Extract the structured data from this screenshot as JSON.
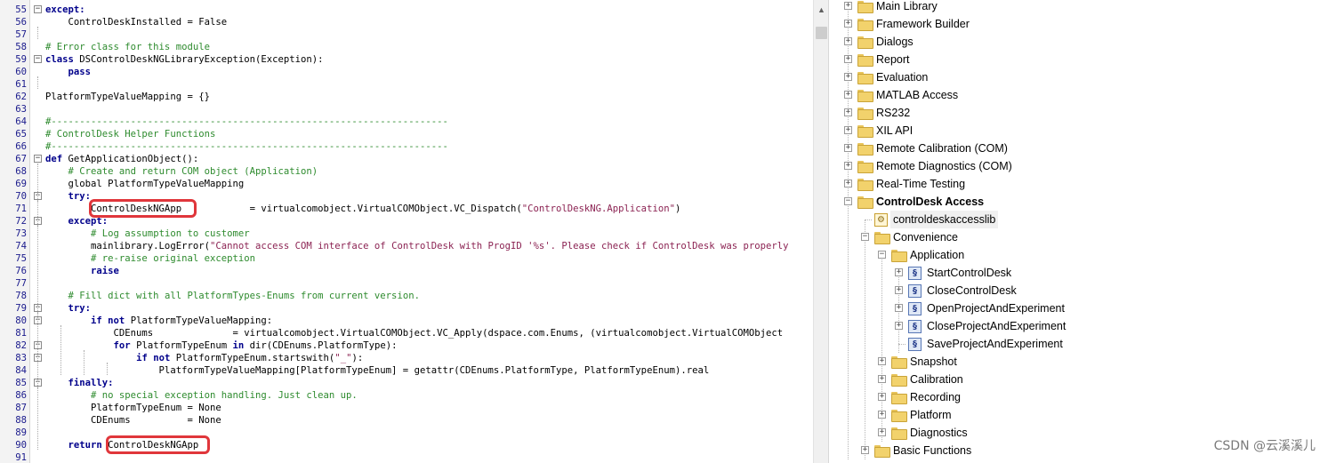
{
  "editor": {
    "lines": [
      {
        "num": "55",
        "fold": "minus",
        "tokens": [
          [
            "kw",
            "except:"
          ]
        ]
      },
      {
        "num": "56",
        "fold": "",
        "tokens": [
          [
            "",
            "    ControlDeskInstalled = False"
          ]
        ]
      },
      {
        "num": "57",
        "fold": "",
        "tokens": []
      },
      {
        "num": "58",
        "fold": "",
        "tokens": [
          [
            "cm",
            "# Error class for this module"
          ]
        ]
      },
      {
        "num": "59",
        "fold": "minus",
        "tokens": [
          [
            "kw",
            "class"
          ],
          [
            "",
            " DSControlDeskNGLibraryException(Exception):"
          ]
        ]
      },
      {
        "num": "60",
        "fold": "",
        "tokens": [
          [
            "",
            "    "
          ],
          [
            "kw",
            "pass"
          ]
        ]
      },
      {
        "num": "61",
        "fold": "",
        "tokens": []
      },
      {
        "num": "62",
        "fold": "",
        "tokens": [
          [
            "",
            "PlatformTypeValueMapping = {}"
          ]
        ]
      },
      {
        "num": "63",
        "fold": "",
        "tokens": []
      },
      {
        "num": "64",
        "fold": "",
        "tokens": [
          [
            "cm",
            "#----------------------------------------------------------------------"
          ]
        ]
      },
      {
        "num": "65",
        "fold": "",
        "tokens": [
          [
            "cm",
            "# ControlDesk Helper Functions"
          ]
        ]
      },
      {
        "num": "66",
        "fold": "",
        "tokens": [
          [
            "cm",
            "#----------------------------------------------------------------------"
          ]
        ]
      },
      {
        "num": "67",
        "fold": "minus",
        "tokens": [
          [
            "kw",
            "def"
          ],
          [
            "",
            " GetApplicationObject():"
          ]
        ]
      },
      {
        "num": "68",
        "fold": "",
        "tokens": [
          [
            "",
            "    "
          ],
          [
            "cm",
            "# Create and return COM object (Application)"
          ]
        ]
      },
      {
        "num": "69",
        "fold": "",
        "tokens": [
          [
            "",
            "    global PlatformTypeValueMapping"
          ]
        ]
      },
      {
        "num": "70",
        "fold": "minus",
        "tokens": [
          [
            "",
            "    "
          ],
          [
            "kw",
            "try:"
          ]
        ]
      },
      {
        "num": "71",
        "fold": "",
        "tokens": [
          [
            "",
            "        ControlDeskNGApp            = virtualcomobject.VirtualCOMObject.VC_Dispatch("
          ],
          [
            "st",
            "\"ControlDeskNG.Application\""
          ],
          [
            "",
            ")"
          ]
        ]
      },
      {
        "num": "72",
        "fold": "minus",
        "tokens": [
          [
            "",
            "    "
          ],
          [
            "kw",
            "except:"
          ]
        ]
      },
      {
        "num": "73",
        "fold": "",
        "tokens": [
          [
            "",
            "        "
          ],
          [
            "cm",
            "# Log assumption to customer"
          ]
        ]
      },
      {
        "num": "74",
        "fold": "",
        "tokens": [
          [
            "",
            "        mainlibrary.LogError("
          ],
          [
            "st",
            "\"Cannot access COM interface of ControlDesk with ProgID '%s'. Please check if ControlDesk was properly"
          ]
        ]
      },
      {
        "num": "75",
        "fold": "",
        "tokens": [
          [
            "",
            "        "
          ],
          [
            "cm",
            "# re-raise original exception"
          ]
        ]
      },
      {
        "num": "76",
        "fold": "",
        "tokens": [
          [
            "",
            "        "
          ],
          [
            "kw",
            "raise"
          ]
        ]
      },
      {
        "num": "77",
        "fold": "",
        "tokens": []
      },
      {
        "num": "78",
        "fold": "",
        "tokens": [
          [
            "",
            "    "
          ],
          [
            "cm",
            "# Fill dict with all PlatformTypes-Enums from current version."
          ]
        ]
      },
      {
        "num": "79",
        "fold": "minus",
        "tokens": [
          [
            "",
            "    "
          ],
          [
            "kw",
            "try:"
          ]
        ]
      },
      {
        "num": "80",
        "fold": "minus",
        "tokens": [
          [
            "",
            "        "
          ],
          [
            "kw",
            "if not"
          ],
          [
            "",
            " PlatformTypeValueMapping:"
          ]
        ]
      },
      {
        "num": "81",
        "fold": "",
        "tokens": [
          [
            "",
            "            CDEnums              = virtualcomobject.VirtualCOMObject.VC_Apply(dspace.com.Enums, (virtualcomobject.VirtualCOMObject"
          ]
        ]
      },
      {
        "num": "82",
        "fold": "minus",
        "tokens": [
          [
            "",
            "            "
          ],
          [
            "kw",
            "for"
          ],
          [
            "",
            " PlatformTypeEnum "
          ],
          [
            "kw",
            "in"
          ],
          [
            "",
            " dir(CDEnums.PlatformType):"
          ]
        ]
      },
      {
        "num": "83",
        "fold": "minus",
        "tokens": [
          [
            "",
            "                "
          ],
          [
            "kw",
            "if not"
          ],
          [
            "",
            " PlatformTypeEnum.startswith("
          ],
          [
            "st",
            "\"_\""
          ],
          [
            "",
            "):"
          ]
        ]
      },
      {
        "num": "84",
        "fold": "",
        "tokens": [
          [
            "",
            "                    PlatformTypeValueMapping[PlatformTypeEnum] = getattr(CDEnums.PlatformType, PlatformTypeEnum).real"
          ]
        ]
      },
      {
        "num": "85",
        "fold": "minus",
        "tokens": [
          [
            "",
            "    "
          ],
          [
            "kw",
            "finally:"
          ]
        ]
      },
      {
        "num": "86",
        "fold": "",
        "tokens": [
          [
            "",
            "        "
          ],
          [
            "cm",
            "# no special exception handling. Just clean up."
          ]
        ]
      },
      {
        "num": "87",
        "fold": "",
        "tokens": [
          [
            "",
            "        PlatformTypeEnum = None"
          ]
        ]
      },
      {
        "num": "88",
        "fold": "",
        "tokens": [
          [
            "",
            "        CDEnums          = None"
          ]
        ]
      },
      {
        "num": "89",
        "fold": "",
        "tokens": []
      },
      {
        "num": "90",
        "fold": "",
        "tokens": [
          [
            "",
            "    "
          ],
          [
            "kw",
            "return"
          ],
          [
            "",
            " ControlDeskNGApp"
          ]
        ]
      },
      {
        "num": "91",
        "fold": "",
        "tokens": []
      }
    ]
  },
  "tree": {
    "items": [
      {
        "label": "Main Library",
        "level": 0,
        "icon": "folder-icon",
        "expander": "plus",
        "bold": false
      },
      {
        "label": "Framework Builder",
        "level": 0,
        "icon": "folder-icon",
        "expander": "plus",
        "bold": false
      },
      {
        "label": "Dialogs",
        "level": 0,
        "icon": "folder-icon",
        "expander": "plus",
        "bold": false
      },
      {
        "label": "Report",
        "level": 0,
        "icon": "folder-icon",
        "expander": "plus",
        "bold": false
      },
      {
        "label": "Evaluation",
        "level": 0,
        "icon": "folder-icon",
        "expander": "plus",
        "bold": false
      },
      {
        "label": "MATLAB Access",
        "level": 0,
        "icon": "folder-icon",
        "expander": "plus",
        "bold": false
      },
      {
        "label": "RS232",
        "level": 0,
        "icon": "folder-icon",
        "expander": "plus",
        "bold": false
      },
      {
        "label": "XIL API",
        "level": 0,
        "icon": "folder-icon",
        "expander": "plus",
        "bold": false
      },
      {
        "label": "Remote Calibration (COM)",
        "level": 0,
        "icon": "folder-icon",
        "expander": "plus",
        "bold": false
      },
      {
        "label": "Remote Diagnostics (COM)",
        "level": 0,
        "icon": "folder-icon",
        "expander": "plus",
        "bold": false
      },
      {
        "label": "Real-Time Testing",
        "level": 0,
        "icon": "folder-icon",
        "expander": "plus",
        "bold": false
      },
      {
        "label": "ControlDesk Access",
        "level": 0,
        "icon": "folder-icon",
        "expander": "minus",
        "bold": true
      },
      {
        "label": "controldeskaccesslib",
        "level": 1,
        "icon": "library-icon",
        "expander": "",
        "bold": false,
        "selected": true
      },
      {
        "label": "Convenience",
        "level": 1,
        "icon": "folder-icon",
        "expander": "minus",
        "bold": false
      },
      {
        "label": "Application",
        "level": 2,
        "icon": "folder-icon",
        "expander": "minus",
        "bold": false
      },
      {
        "label": "StartControlDesk",
        "level": 3,
        "icon": "script-icon",
        "expander": "plus",
        "bold": false
      },
      {
        "label": "CloseControlDesk",
        "level": 3,
        "icon": "script-icon",
        "expander": "plus",
        "bold": false
      },
      {
        "label": "OpenProjectAndExperiment",
        "level": 3,
        "icon": "script-icon",
        "expander": "plus",
        "bold": false
      },
      {
        "label": "CloseProjectAndExperiment",
        "level": 3,
        "icon": "script-icon",
        "expander": "plus",
        "bold": false
      },
      {
        "label": "SaveProjectAndExperiment",
        "level": 3,
        "icon": "script-icon",
        "expander": "",
        "bold": false
      },
      {
        "label": "Snapshot",
        "level": 2,
        "icon": "folder-icon",
        "expander": "plus",
        "bold": false
      },
      {
        "label": "Calibration",
        "level": 2,
        "icon": "folder-icon",
        "expander": "plus",
        "bold": false
      },
      {
        "label": "Recording",
        "level": 2,
        "icon": "folder-icon",
        "expander": "plus",
        "bold": false
      },
      {
        "label": "Platform",
        "level": 2,
        "icon": "folder-icon",
        "expander": "plus",
        "bold": false
      },
      {
        "label": "Diagnostics",
        "level": 2,
        "icon": "folder-icon",
        "expander": "plus",
        "bold": false
      },
      {
        "label": "Basic Functions",
        "level": 1,
        "icon": "folder-icon",
        "expander": "plus",
        "bold": false
      }
    ]
  },
  "watermark": "CSDN @云溪溪儿",
  "colors": {
    "highlight": "#e0363b",
    "keyword": "#00008b",
    "comment": "#2e8b2e",
    "string": "#8b2252"
  }
}
